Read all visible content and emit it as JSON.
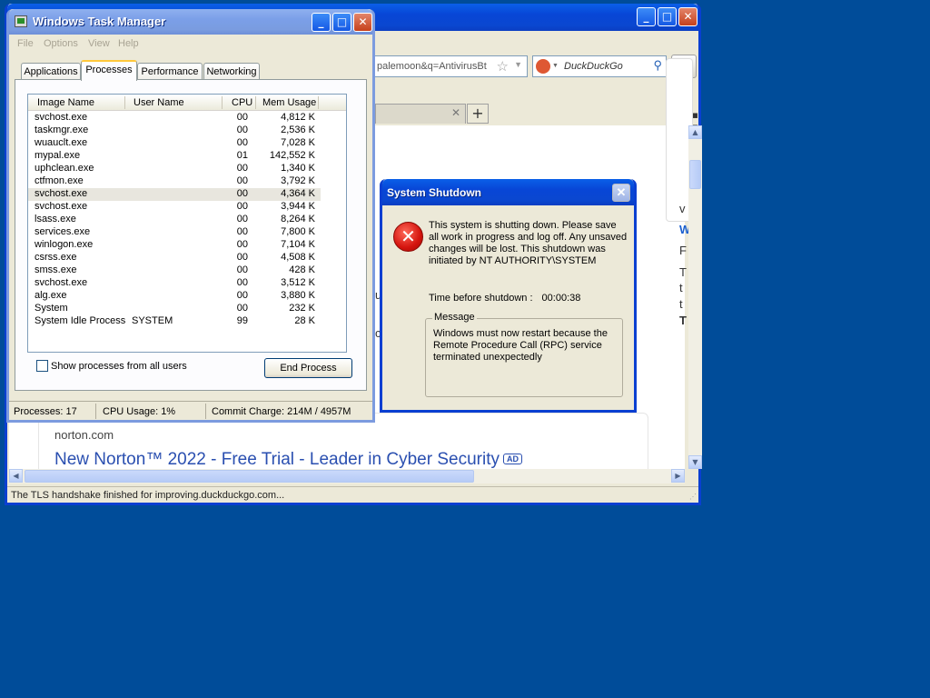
{
  "browser": {
    "url_fragment": "palemoon&q=AntivirusBt",
    "search_engine": "DuckDuckGo",
    "search_placeholder": "DuckDuckGo",
    "result_domain": "norton.com",
    "result_title": "New Norton™ 2022 - Free Trial - Leader in Cyber Security",
    "ad_badge": "AD",
    "status_text": "The TLS handshake finished for improving.duckduckgo.com...",
    "clipped_right": [
      "v",
      "W",
      "F",
      "T",
      "t",
      "t",
      "T"
    ],
    "clipped_mid": [
      "u",
      "c"
    ]
  },
  "taskmgr": {
    "title": "Windows Task Manager",
    "menu": [
      "File",
      "Options",
      "View",
      "Help"
    ],
    "tabs": [
      "Applications",
      "Processes",
      "Performance",
      "Networking"
    ],
    "active_tab": "Processes",
    "columns": [
      "Image Name",
      "User Name",
      "CPU",
      "Mem Usage"
    ],
    "rows": [
      {
        "name": "svchost.exe",
        "user": "",
        "cpu": "00",
        "mem": "4,812 K"
      },
      {
        "name": "taskmgr.exe",
        "user": "",
        "cpu": "00",
        "mem": "2,536 K"
      },
      {
        "name": "wuauclt.exe",
        "user": "",
        "cpu": "00",
        "mem": "7,028 K"
      },
      {
        "name": "mypal.exe",
        "user": "",
        "cpu": "01",
        "mem": "142,552 K"
      },
      {
        "name": "uphclean.exe",
        "user": "",
        "cpu": "00",
        "mem": "1,340 K"
      },
      {
        "name": "ctfmon.exe",
        "user": "",
        "cpu": "00",
        "mem": "3,792 K"
      },
      {
        "name": "svchost.exe",
        "user": "",
        "cpu": "00",
        "mem": "4,364 K",
        "selected": true
      },
      {
        "name": "svchost.exe",
        "user": "",
        "cpu": "00",
        "mem": "3,944 K"
      },
      {
        "name": "lsass.exe",
        "user": "",
        "cpu": "00",
        "mem": "8,264 K"
      },
      {
        "name": "services.exe",
        "user": "",
        "cpu": "00",
        "mem": "7,800 K"
      },
      {
        "name": "winlogon.exe",
        "user": "",
        "cpu": "00",
        "mem": "7,104 K"
      },
      {
        "name": "csrss.exe",
        "user": "",
        "cpu": "00",
        "mem": "4,508 K"
      },
      {
        "name": "smss.exe",
        "user": "",
        "cpu": "00",
        "mem": "428 K"
      },
      {
        "name": "svchost.exe",
        "user": "",
        "cpu": "00",
        "mem": "3,512 K"
      },
      {
        "name": "alg.exe",
        "user": "",
        "cpu": "00",
        "mem": "3,880 K"
      },
      {
        "name": "System",
        "user": "",
        "cpu": "00",
        "mem": "232 K"
      },
      {
        "name": "System Idle Process",
        "user": "SYSTEM",
        "cpu": "99",
        "mem": "28 K"
      }
    ],
    "show_all_label": "Show processes from all users",
    "end_process_label": "End Process",
    "status": {
      "processes": "Processes: 17",
      "cpu": "CPU Usage: 1%",
      "commit": "Commit Charge: 214M / 4957M"
    }
  },
  "shutdown": {
    "title": "System Shutdown",
    "body": "This system is shutting down. Please save all work in progress and log off. Any unsaved changes will be lost. This shutdown was initiated by NT AUTHORITY\\SYSTEM",
    "time_label": "Time before shutdown :",
    "time_value": "00:00:38",
    "message_legend": "Message",
    "message": "Windows must now restart because the Remote Procedure Call (RPC) service terminated unexpectedly"
  },
  "colors": {
    "desktop": "#004c99",
    "title_active": "#0a47d0",
    "title_inactive": "#7b9fe8",
    "error_red": "#d4140e"
  }
}
